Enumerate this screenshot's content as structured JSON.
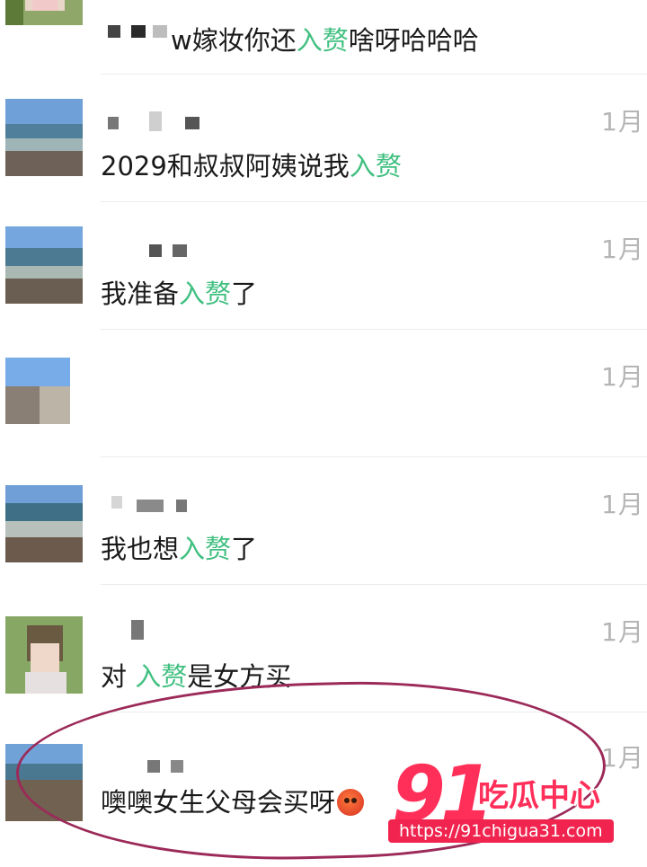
{
  "comments": [
    {
      "time": "",
      "parts": [
        {
          "t": "w嫁妆你还",
          "h": false
        },
        {
          "t": "入赘",
          "h": true
        },
        {
          "t": "啥呀哈哈哈",
          "h": false
        }
      ]
    },
    {
      "time": "1月",
      "parts": [
        {
          "t": "2029和叔叔阿姨说我",
          "h": false
        },
        {
          "t": "入赘",
          "h": true
        }
      ]
    },
    {
      "time": "1月",
      "parts": [
        {
          "t": "我准备",
          "h": false
        },
        {
          "t": "入赘",
          "h": true
        },
        {
          "t": "了",
          "h": false
        }
      ]
    },
    {
      "time": "1月",
      "parts": []
    },
    {
      "time": "1月",
      "parts": [
        {
          "t": "我也想",
          "h": false
        },
        {
          "t": "入赘",
          "h": true
        },
        {
          "t": "了",
          "h": false
        }
      ]
    },
    {
      "time": "1月",
      "parts": [
        {
          "t": "对 ",
          "h": false
        },
        {
          "t": "入赘",
          "h": true
        },
        {
          "t": "是女方买",
          "h": false
        }
      ]
    },
    {
      "time": "1月",
      "parts": [
        {
          "t": "噢噢女生父母会买呀",
          "h": false
        }
      ],
      "emoji": "angry-face-emoji"
    }
  ],
  "watermark": {
    "number": "91",
    "text": "吃瓜中心",
    "url": "https://91chigua31.com"
  },
  "colors": {
    "highlight": "#3fbf7f",
    "time": "#b5b5b5",
    "circle": "#9c2a59",
    "watermark": "#ff2f5a"
  }
}
